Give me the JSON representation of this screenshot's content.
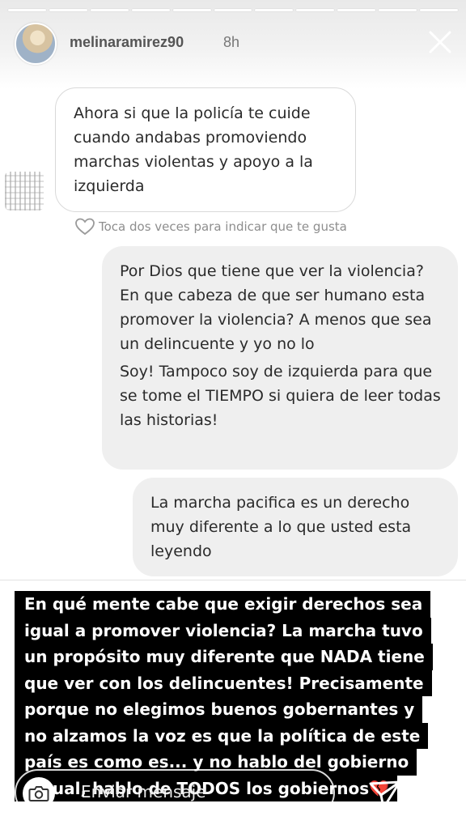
{
  "story": {
    "progress_segment_count": 11,
    "username": "melinaramirez90",
    "time_ago": "8h"
  },
  "thread": {
    "received": {
      "text": "Ahora si que la policía te cuide cuando andabas promoviendo marchas violentas y apoyo a la izquierda"
    },
    "like_hint": "Toca dos veces para indicar que te gusta",
    "sent": [
      {
        "paragraphs": [
          "Por Dios que tiene que ver la violencia? En que cabeza de que ser humano esta promover la violencia? A menos que sea un delincuente y yo no lo",
          "Soy! Tampoco soy de izquierda para que se tome el TIEMPO si quiera de leer todas las historias!"
        ]
      },
      {
        "text": "La marcha pacifica es un derecho muy diferente a lo que usted esta leyendo"
      }
    ]
  },
  "caption": {
    "lines": [
      "En qué mente cabe que exigir derechos sea",
      "igual a promover violencia? La marcha tuvo",
      "un propósito muy diferente que NADA tiene",
      "que ver con los delincuentes!  Precisamente",
      "porque no elegimos buenos gobernantes y",
      "no alzamos la voz es que la política de este",
      "país es como es... y no hablo del gobierno",
      "actual, hablo de TODOS los gobiernos💔"
    ]
  },
  "composer": {
    "placeholder": "Enviar mensaje"
  },
  "icons": {
    "close": "close-icon",
    "heart": "heart-outline-icon",
    "camera": "camera-icon",
    "send": "paper-plane-icon",
    "more": "more-dots-icon"
  }
}
